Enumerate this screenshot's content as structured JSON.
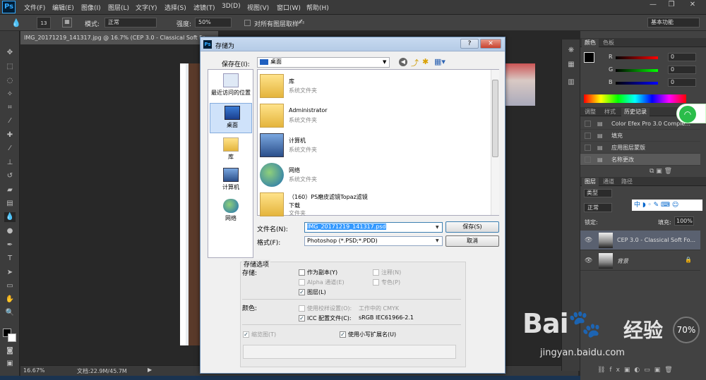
{
  "app": {
    "logo": "Ps"
  },
  "menu": [
    "文件(F)",
    "编辑(E)",
    "图像(I)",
    "图层(L)",
    "文字(Y)",
    "选择(S)",
    "滤镜(T)",
    "3D(D)",
    "视图(V)",
    "窗口(W)",
    "帮助(H)"
  ],
  "options": {
    "brush_size": "13",
    "mode_label": "模式:",
    "mode_value": "正常",
    "strength_label": "强度:",
    "strength_value": "50%",
    "sample_all_label": "对所有图层取样",
    "workspace": "基本功能"
  },
  "document": {
    "tab_title": "IMG_20171219_141317.jpg @ 16.7% (CEP 3.0 - Classical Soft Fo...",
    "zoom": "16.67%",
    "doc_info": "文档:22.9M/45.7M"
  },
  "panels": {
    "color_tabs": [
      "颜色",
      "色板"
    ],
    "rgb": [
      {
        "label": "R",
        "value": "0"
      },
      {
        "label": "G",
        "value": "0"
      },
      {
        "label": "B",
        "value": "0"
      }
    ],
    "history_tabs": [
      "调整",
      "样式",
      "历史记录"
    ],
    "history_items": [
      "Color Efex Pro 3.0 Comple...",
      "填充",
      "应用图层蒙版",
      "名称更改"
    ],
    "layers_tabs": [
      "图层",
      "通道",
      "路径"
    ],
    "layer_filter": "类型",
    "blend_mode": "正常",
    "lock_label": "锁定:",
    "fill_label": "填充:",
    "fill_value": "100%",
    "layers": [
      "CEP 3.0 - Classical Soft Fo...",
      "背景"
    ]
  },
  "dialog": {
    "title": "存储为",
    "save_in_label": "保存在(I):",
    "save_in_value": "桌面",
    "places": [
      "最近访问的位置",
      "桌面",
      "库",
      "计算机",
      "网络"
    ],
    "files": [
      {
        "name": "库",
        "desc": "系统文件夹"
      },
      {
        "name": "Administrator",
        "desc": "系统文件夹"
      },
      {
        "name": "计算机",
        "desc": "系统文件夹"
      },
      {
        "name": "网络",
        "desc": "系统文件夹"
      },
      {
        "name": "（160）PS磨皮滤镜Topaz滤镜",
        "name2": "下载",
        "desc": "文件夹"
      }
    ],
    "filename_label": "文件名(N):",
    "filename_value": "IMG_20171219_141317.psd",
    "format_label": "格式(F):",
    "format_value": "Photoshop (*.PSD;*.PDD)",
    "save_button": "保存(S)",
    "cancel_button": "取消",
    "options_title": "存储选项",
    "store_label": "存储:",
    "as_copy": "作为副本(Y)",
    "notes": "注释(N)",
    "alpha": "Alpha 通道(E)",
    "spot": "专色(P)",
    "layers": "图层(L)",
    "color_label": "颜色:",
    "proof": "使用校样设置(O):",
    "proof_value": "工作中的 CMYK",
    "icc": "ICC 配置文件(C):",
    "icc_value": "sRGB IEC61966-2.1",
    "thumbnail": "缩览图(T)",
    "lowercase": "使用小写扩展名(U)"
  },
  "overlay": {
    "percent": "70%",
    "brand": "Bai",
    "brand2": "经验",
    "url": "jingyan.baidu.com"
  },
  "colors": {
    "ps_bg": "#282828",
    "panel": "#424242",
    "accent": "#31a8ff",
    "dialog_title": "#b5cbe6"
  }
}
